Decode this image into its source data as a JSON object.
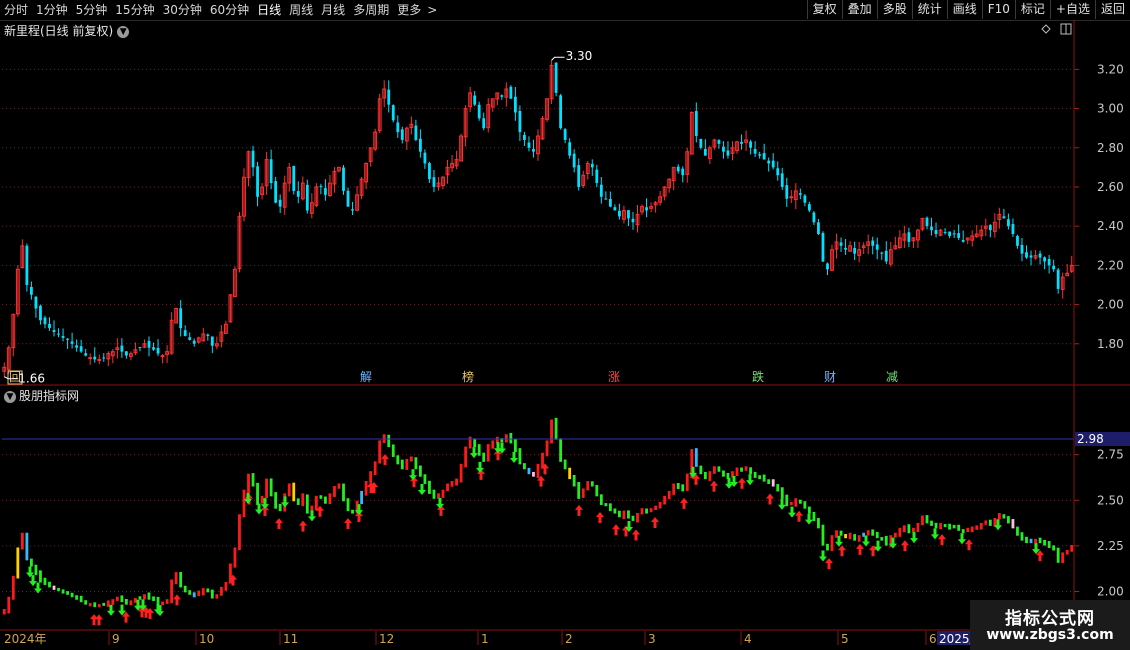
{
  "toolbar": {
    "periods": [
      "分时",
      "1分钟",
      "5分钟",
      "15分钟",
      "30分钟",
      "60分钟",
      "日线",
      "周线",
      "月线",
      "多周期",
      "更多"
    ],
    "active_period": "日线",
    "more_chevron": ">",
    "right_buttons": [
      "复权",
      "叠加",
      "多股",
      "统计",
      "画线",
      "F10",
      "标记",
      "+自选",
      "返回"
    ]
  },
  "main_panel": {
    "title": "新里程(日线 前复权)",
    "chevron": "v",
    "high_label": "3.30",
    "low_label": "1.66",
    "y_ticks": [
      "3.20",
      "3.00",
      "2.80",
      "2.60",
      "2.40",
      "2.20",
      "2.00",
      "1.80"
    ],
    "markers": [
      {
        "text": "回",
        "color": "#e8c46a",
        "boxed": true
      },
      {
        "text": "解",
        "color": "#6fb7ff"
      },
      {
        "text": "榜",
        "color": "#e8c46a"
      },
      {
        "text": "涨",
        "color": "#ff4a4a"
      },
      {
        "text": "跌",
        "color": "#6fe36f"
      },
      {
        "text": "财",
        "color": "#6fb7ff"
      },
      {
        "text": "减",
        "color": "#6fe36f"
      }
    ]
  },
  "sub_panel": {
    "title": "股朋指标网",
    "y_ticks": [
      "2.75",
      "2.50",
      "2.25",
      "2.00"
    ],
    "current_value": "2.98"
  },
  "x_axis": {
    "labels": [
      "2024年",
      "9",
      "10",
      "11",
      "12",
      "1",
      "2",
      "3",
      "4",
      "5",
      "6",
      "2025/0"
    ]
  },
  "watermark": {
    "line1": "指标公式网",
    "line2": "www.zbgs3.com"
  },
  "colors": {
    "up": "#ff3030",
    "down": "#00e0ff",
    "indicator_up": "#ff1a1a",
    "indicator_down": "#22ee22",
    "up_arrow": "#ff2020",
    "down_arrow": "#22ee22",
    "grid": "#7a1a1a",
    "panel_border": "#8b1010"
  },
  "chart_data": {
    "type": "candlestick",
    "title": "新里程(日线 前复权)",
    "y_range": [
      1.6,
      3.36
    ],
    "close_series": [
      1.68,
      1.78,
      1.95,
      2.18,
      2.3,
      2.1,
      2.05,
      1.98,
      1.92,
      1.9,
      1.88,
      1.86,
      1.85,
      1.83,
      1.82,
      1.8,
      1.78,
      1.76,
      1.74,
      1.73,
      1.72,
      1.72,
      1.73,
      1.75,
      1.76,
      1.78,
      1.76,
      1.74,
      1.75,
      1.77,
      1.78,
      1.8,
      1.78,
      1.77,
      1.75,
      1.74,
      1.76,
      1.92,
      1.98,
      1.88,
      1.84,
      1.82,
      1.8,
      1.83,
      1.85,
      1.84,
      1.79,
      1.8,
      1.86,
      1.9,
      2.05,
      2.18,
      2.45,
      2.65,
      2.78,
      2.7,
      2.55,
      2.6,
      2.74,
      2.62,
      2.52,
      2.5,
      2.62,
      2.7,
      2.58,
      2.55,
      2.62,
      2.48,
      2.52,
      2.6,
      2.6,
      2.56,
      2.62,
      2.68,
      2.7,
      2.58,
      2.5,
      2.48,
      2.56,
      2.64,
      2.72,
      2.8,
      2.88,
      3.05,
      3.1,
      3.02,
      2.94,
      2.88,
      2.84,
      2.9,
      2.92,
      2.84,
      2.78,
      2.72,
      2.64,
      2.6,
      2.62,
      2.65,
      2.7,
      2.72,
      2.74,
      2.86,
      3.0,
      3.08,
      3.02,
      2.95,
      2.9,
      3.02,
      3.05,
      3.08,
      3.06,
      3.1,
      3.05,
      2.98,
      2.88,
      2.84,
      2.8,
      2.78,
      2.86,
      2.95,
      3.05,
      3.22,
      3.08,
      2.9,
      2.84,
      2.76,
      2.7,
      2.6,
      2.66,
      2.72,
      2.7,
      2.62,
      2.55,
      2.54,
      2.5,
      2.48,
      2.45,
      2.48,
      2.44,
      2.42,
      2.46,
      2.5,
      2.48,
      2.5,
      2.52,
      2.55,
      2.6,
      2.64,
      2.7,
      2.68,
      2.66,
      2.78,
      2.98,
      2.86,
      2.8,
      2.76,
      2.8,
      2.84,
      2.82,
      2.78,
      2.76,
      2.8,
      2.83,
      2.82,
      2.84,
      2.8,
      2.77,
      2.76,
      2.74,
      2.72,
      2.7,
      2.66,
      2.6,
      2.54,
      2.55,
      2.58,
      2.56,
      2.52,
      2.48,
      2.42,
      2.36,
      2.22,
      2.18,
      2.28,
      2.32,
      2.3,
      2.28,
      2.3,
      2.26,
      2.28,
      2.3,
      2.32,
      2.3,
      2.28,
      2.26,
      2.22,
      2.28,
      2.3,
      2.34,
      2.36,
      2.32,
      2.34,
      2.38,
      2.44,
      2.4,
      2.38,
      2.36,
      2.38,
      2.37,
      2.35,
      2.36,
      2.34,
      2.32,
      2.34,
      2.35,
      2.36,
      2.38,
      2.4,
      2.38,
      2.42,
      2.46,
      2.44,
      2.4,
      2.36,
      2.3,
      2.26,
      2.24,
      2.24,
      2.25,
      2.24,
      2.22,
      2.2,
      2.18,
      2.08,
      2.14,
      2.16,
      2.2
    ]
  },
  "indicator_data": {
    "type": "bar",
    "y_range": [
      1.8,
      3.05
    ],
    "up_arrow_days": [
      94,
      99,
      126,
      142,
      146,
      150,
      177,
      233,
      249,
      265,
      279,
      303,
      320,
      348,
      359,
      371,
      374,
      385,
      414,
      441,
      481,
      498,
      541,
      545,
      579,
      600,
      616,
      626,
      636,
      655,
      684,
      696,
      714,
      742,
      770,
      799,
      829,
      842,
      860,
      873,
      905,
      942,
      969,
      1040
    ],
    "down_arrow_days": [
      30,
      33,
      38,
      111,
      122,
      138,
      143,
      158,
      160,
      248,
      259,
      265,
      285,
      312,
      359,
      413,
      422,
      440,
      474,
      480,
      498,
      502,
      514,
      629,
      693,
      729,
      734,
      750,
      782,
      792,
      809,
      823,
      839,
      866,
      878,
      893,
      914,
      935,
      962,
      998,
      1036
    ]
  }
}
